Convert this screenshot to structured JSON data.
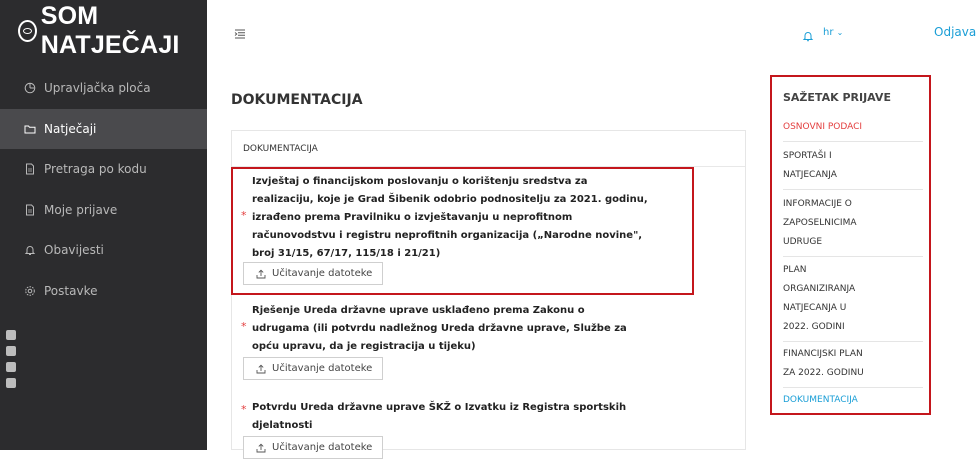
{
  "app": {
    "logo": "SOM NATJEČAJI",
    "logout": "Odjava",
    "lang": "hr"
  },
  "sidebar": {
    "items": [
      {
        "label": "Upravljačka ploča",
        "icon": "dashboard-icon"
      },
      {
        "label": "Natječaji",
        "icon": "folder-icon",
        "active": true
      },
      {
        "label": "Pretraga po kodu",
        "icon": "document-icon"
      },
      {
        "label": "Moje prijave",
        "icon": "document-icon"
      },
      {
        "label": "Obavijesti",
        "icon": "bell-icon"
      },
      {
        "label": "Postavke",
        "icon": "gear-icon"
      }
    ]
  },
  "main": {
    "page_title": "DOKUMENTACIJA",
    "card_title": "DOKUMENTACIJA",
    "documents": [
      {
        "lines": [
          "Izvještaj o financijskom poslovanju o korištenju sredstva za",
          "realizaciju, koje je Grad Šibenik odobrio podnositelju za 2021. godinu,",
          "izrađeno prema Pravilniku o izvještavanju u neprofitnom",
          "računovodstvu i registru neprofitnih organizacija („Narodne novine\",",
          "broj 31/15, 67/17, 115/18 i 21/21)"
        ],
        "upload_label": "Učitavanje datoteke"
      },
      {
        "lines": [
          "Rješenje Ureda državne uprave usklađeno prema Zakonu o",
          "udrugama (ili potvrdu nadležnog Ureda državne uprave, Službe za",
          "opću upravu, da je registracija u tijeku)"
        ],
        "upload_label": "Učitavanje datoteke"
      },
      {
        "lines": [
          "Potvrdu Ureda državne uprave ŠKŽ o Izvatku iz Registra sportskih",
          "djelatnosti"
        ],
        "upload_label": "Učitavanje datoteke"
      }
    ]
  },
  "summary": {
    "title": "SAŽETAK PRIJAVE",
    "items": [
      {
        "lines": [
          "OSNOVNI PODACI"
        ],
        "color": "#e33e3e"
      },
      {
        "lines": [
          "SPORTAŠI I",
          "NATJECANJA"
        ],
        "color": "#333333"
      },
      {
        "lines": [
          "INFORMACIJE O",
          "ZAPOSELNICIMA",
          "UDRUGE"
        ],
        "color": "#333333"
      },
      {
        "lines": [
          "PLAN",
          "ORGANIZIRANJA",
          "NATJECANJA U",
          "2022. GODINI"
        ],
        "color": "#333333"
      },
      {
        "lines": [
          "FINANCIJSKI PLAN",
          "ZA 2022. GODINU"
        ],
        "color": "#333333"
      },
      {
        "lines": [
          "DOKUMENTACIJA"
        ],
        "color": "#1a9ed6"
      }
    ]
  },
  "colors": {
    "sidebar_bg": "#2c2c2e",
    "active_bg": "#4a4a4d",
    "accent_blue": "#1a9ed6",
    "highlight_red": "#c4161c",
    "required_red": "#e33e3e"
  }
}
